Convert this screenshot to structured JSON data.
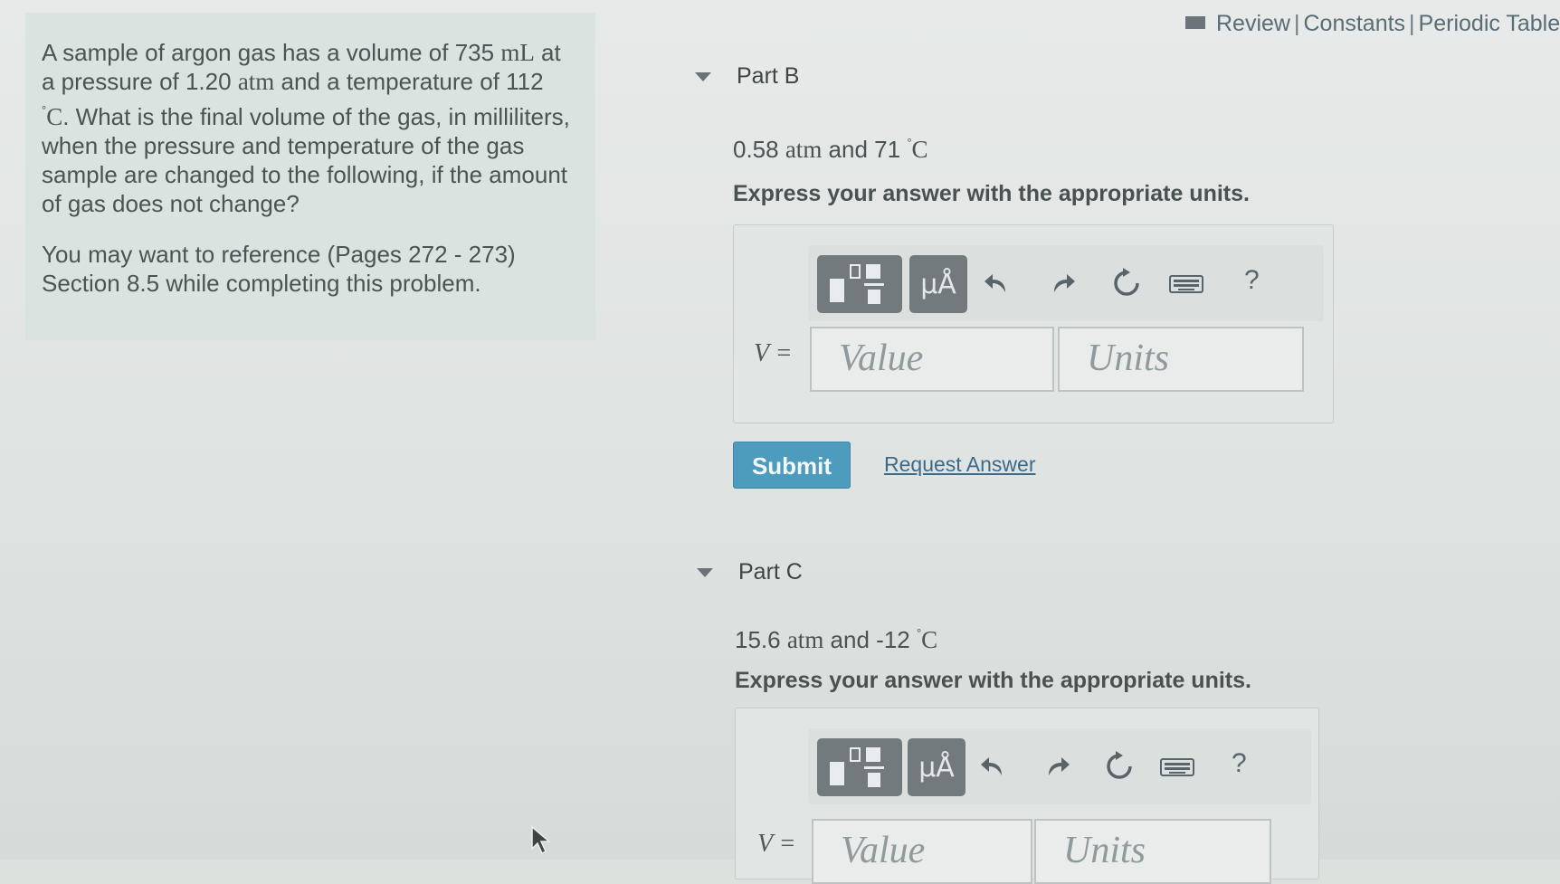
{
  "problem": {
    "text_parts": {
      "p1": "A sample of argon gas has a volume of 735 ",
      "u1": "mL",
      "p2": " at a pressure of 1.20 ",
      "u2": "atm",
      "p3": " and a temperature of 112 ",
      "deg": "°",
      "u3": "C",
      "p4": ". What is the final volume of the gas, in milliliters, when the pressure and temperature of the gas sample are changed to the following, if the amount of gas does not change?"
    },
    "reference": "You may want to reference (Pages 272 - 273) Section 8.5 while completing this problem."
  },
  "top_links": {
    "review": "Review",
    "separator": "|",
    "constants": "Constants",
    "periodic_table": "Periodic Table"
  },
  "part_b": {
    "title": "Part B",
    "given_num1": "0.58 ",
    "given_u1": "atm",
    "given_mid": " and 71 ",
    "given_deg": "°",
    "given_u2": "C",
    "instruction": "Express your answer with the appropriate units.",
    "var_label": "V =",
    "value_placeholder": "Value",
    "units_placeholder": "Units",
    "units_symbol": "µÅ",
    "help": "?",
    "submit": "Submit",
    "request_answer": "Request Answer"
  },
  "part_c": {
    "title": "Part C",
    "given_num1": "15.6 ",
    "given_u1": "atm",
    "given_mid": " and -12 ",
    "given_deg": "°",
    "given_u2": "C",
    "instruction": "Express your answer with the appropriate units.",
    "var_label": "V =",
    "value_placeholder": "Value",
    "units_placeholder": "Units",
    "units_symbol": "µÅ",
    "help": "?"
  },
  "colors": {
    "submit_button": "#4d9bbd",
    "link": "#3a6a8c",
    "problem_panel": "#d9e3df",
    "toolbar_button": "#737a7d"
  },
  "icons": {
    "templates": "fraction-templates-icon",
    "units": "units-icon",
    "undo": "undo-icon",
    "redo": "redo-icon",
    "reset": "reset-icon",
    "keyboard": "keyboard-icon",
    "help": "help-icon",
    "book": "book-icon",
    "collapse": "caret-down-icon",
    "cursor": "cursor-icon"
  }
}
